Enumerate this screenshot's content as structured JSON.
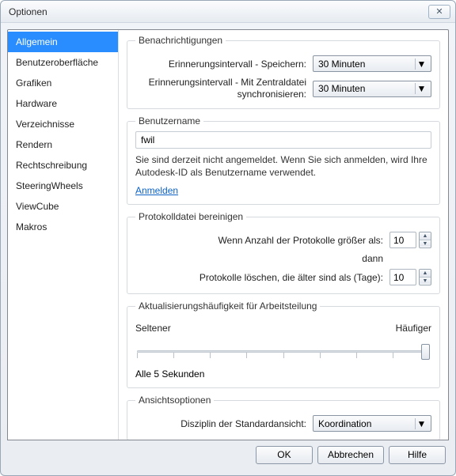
{
  "window": {
    "title": "Optionen",
    "close_glyph": "✕"
  },
  "sidebar": {
    "items": [
      {
        "label": "Allgemein",
        "selected": true
      },
      {
        "label": "Benutzeroberfläche",
        "selected": false
      },
      {
        "label": "Grafiken",
        "selected": false
      },
      {
        "label": "Hardware",
        "selected": false
      },
      {
        "label": "Verzeichnisse",
        "selected": false
      },
      {
        "label": "Rendern",
        "selected": false
      },
      {
        "label": "Rechtschreibung",
        "selected": false
      },
      {
        "label": "SteeringWheels",
        "selected": false
      },
      {
        "label": "ViewCube",
        "selected": false
      },
      {
        "label": "Makros",
        "selected": false
      }
    ]
  },
  "groups": {
    "notifications": {
      "legend": "Benachrichtigungen",
      "save_interval_label": "Erinnerungsintervall - Speichern:",
      "save_interval_value": "30 Minuten",
      "sync_interval_label": "Erinnerungsintervall - Mit Zentraldatei synchronisieren:",
      "sync_interval_value": "30 Minuten"
    },
    "username": {
      "legend": "Benutzername",
      "value": "fwil",
      "note": "Sie sind derzeit nicht angemeldet. Wenn Sie sich anmelden, wird Ihre Autodesk-ID als Benutzername verwendet.",
      "login_link": "Anmelden"
    },
    "log_cleanup": {
      "legend": "Protokolldatei bereinigen",
      "count_label": "Wenn Anzahl der Protokolle größer als:",
      "count_value": "10",
      "then_label": "dann",
      "age_label": "Protokolle löschen, die älter sind als (Tage):",
      "age_value": "10"
    },
    "worksharing_freq": {
      "legend": "Aktualisierungshäufigkeit für Arbeitsteilung",
      "left_label": "Seltener",
      "right_label": "Häufiger",
      "value_caption": "Alle 5 Sekunden",
      "tick_count": 9
    },
    "view_options": {
      "legend": "Ansichtsoptionen",
      "discipline_label": "Disziplin der Standardansicht:",
      "discipline_value": "Koordination"
    }
  },
  "footer": {
    "ok": "OK",
    "cancel": "Abbrechen",
    "help": "Hilfe"
  }
}
